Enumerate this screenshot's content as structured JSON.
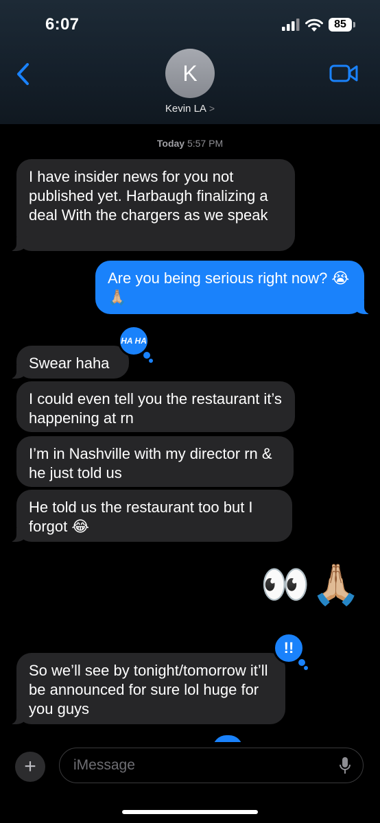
{
  "status": {
    "time": "6:07",
    "battery": "85"
  },
  "header": {
    "avatar_initial": "K",
    "contact_name": "Kevin LA",
    "contact_chevron": ">"
  },
  "timestamp": {
    "day": "Today",
    "time": "5:57 PM"
  },
  "messages": [
    {
      "text": "I have insider news for you not published yet. Harbaugh finalizing a deal With the chargers as we speak",
      "from": "them"
    },
    {
      "text": "Are you being serious right now? 😭🙏🏼",
      "from": "me"
    },
    {
      "text": "Swear haha",
      "from": "them",
      "tapback": "HA HA"
    },
    {
      "text": "I could even tell you the restaurant it’s happening at rn",
      "from": "them"
    },
    {
      "text": "I’m in Nashville with my director rn & he just told us",
      "from": "them"
    },
    {
      "text": "He told us the restaurant too but I forgot 😂",
      "from": "them"
    },
    {
      "text": "👀🙏🏼",
      "from": "me"
    },
    {
      "text": "So we’ll see by tonight/tomorrow it’ll be announced for sure lol huge for you guys",
      "from": "them",
      "tapback": "!!"
    }
  ],
  "input": {
    "placeholder": "iMessage",
    "plus_label": "+"
  },
  "colors": {
    "accent": "#1a82fb",
    "incoming_bubble": "#262628",
    "header_bg": "#15202b"
  },
  "icons": [
    "cellular-signal-icon",
    "wifi-icon",
    "battery-icon",
    "back-chevron-icon",
    "video-camera-icon",
    "plus-icon",
    "microphone-icon"
  ]
}
